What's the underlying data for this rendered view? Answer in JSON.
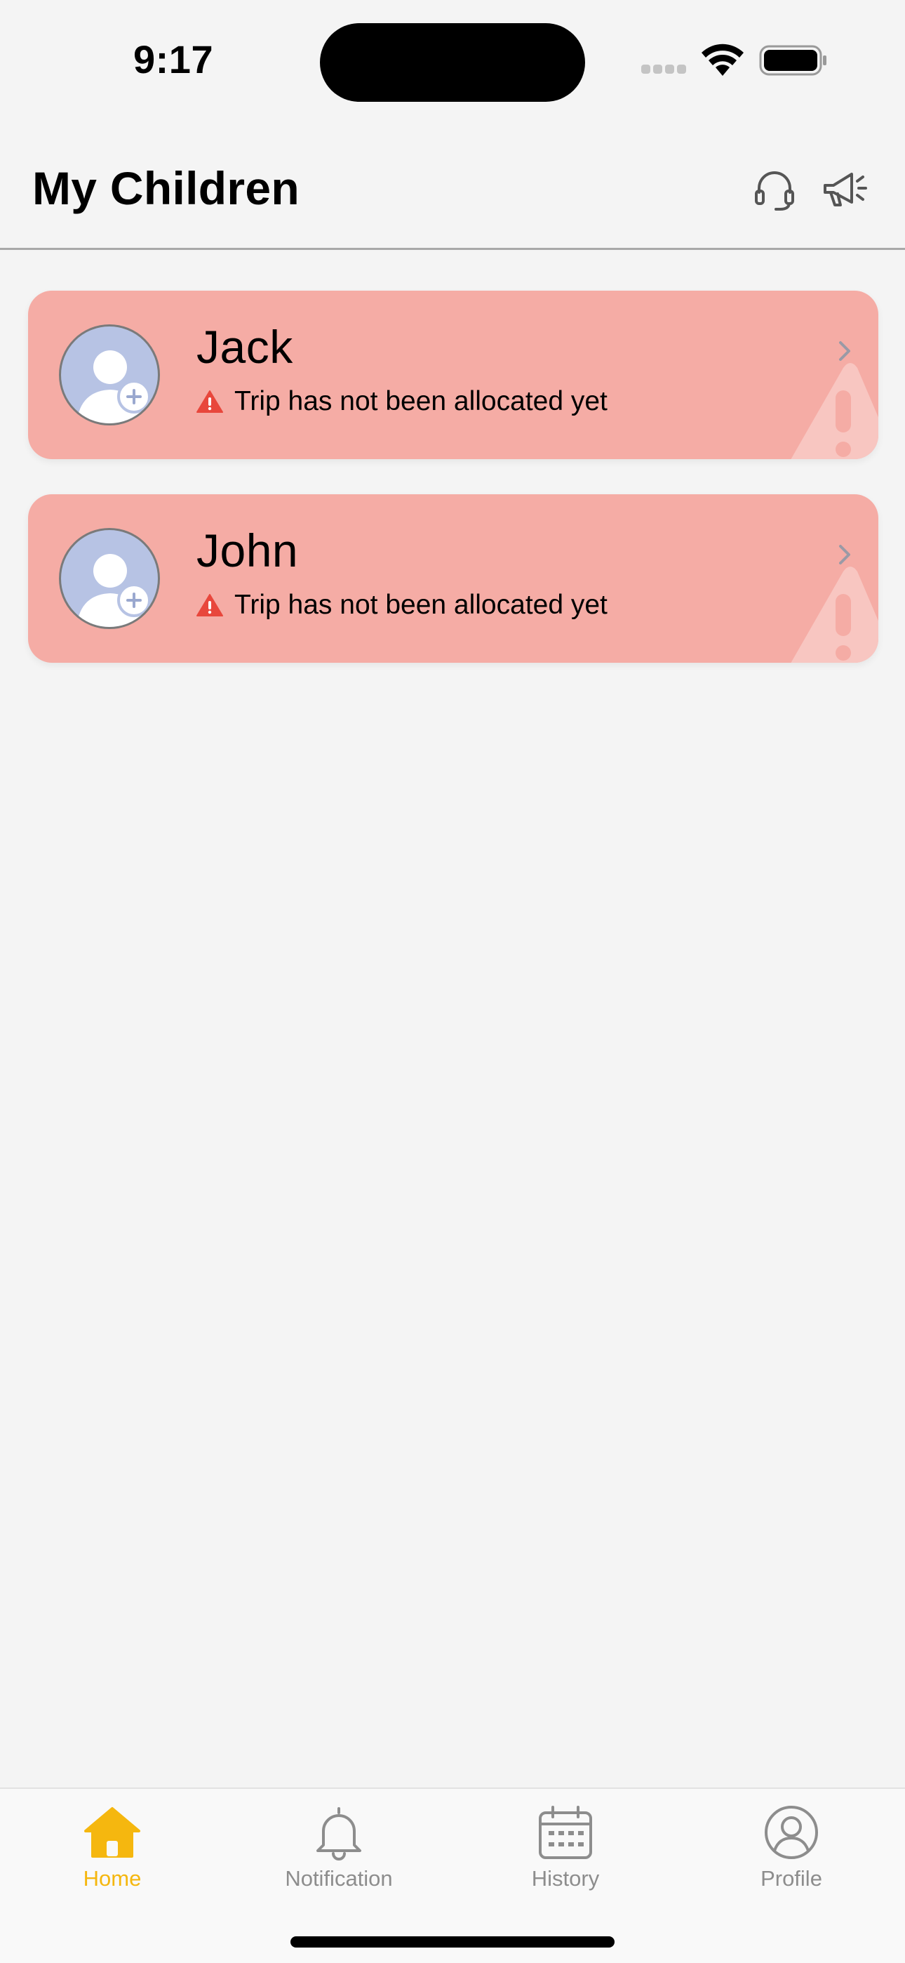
{
  "status_bar": {
    "time": "9:17",
    "icons": [
      "cellular-signal-icon",
      "wifi-icon",
      "battery-icon"
    ]
  },
  "header": {
    "title": "My Children",
    "actions": [
      "headset-support-icon",
      "megaphone-icon"
    ]
  },
  "children": [
    {
      "name": "Jack",
      "status": "Trip has not been allocated yet"
    },
    {
      "name": "John",
      "status": "Trip has not been allocated yet"
    }
  ],
  "tab_bar": {
    "tabs": [
      {
        "label": "Home",
        "icon": "home-icon",
        "active": true
      },
      {
        "label": "Notification",
        "icon": "bell-icon",
        "active": false
      },
      {
        "label": "History",
        "icon": "calendar-icon",
        "active": false
      },
      {
        "label": "Profile",
        "icon": "user-circle-icon",
        "active": false
      }
    ]
  },
  "colors": {
    "background": "#f4f4f4",
    "card": "#f5aca5",
    "alert": "#e8473c",
    "active_tab": "#f5b70f",
    "inactive_tab": "#8d8d8d",
    "avatar": "#b7c3e4"
  }
}
